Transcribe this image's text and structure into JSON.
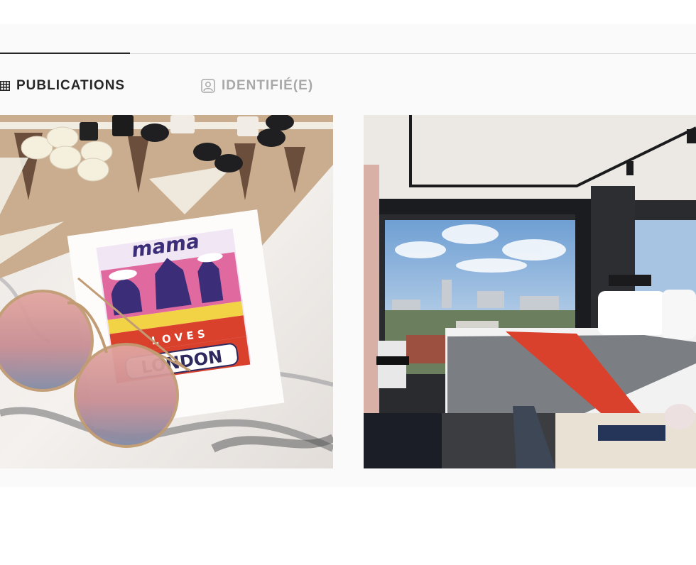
{
  "tabs": [
    {
      "label": "PUBLICATIONS",
      "icon": "grid-icon",
      "active": true
    },
    {
      "label": "IDENTIFIÉ(E)",
      "icon": "tagged-user-icon",
      "active": false
    }
  ],
  "posts": [
    {
      "image": "backgammon-board-sunglasses-card",
      "card_text": {
        "top": "mama",
        "middle": "L O V E S",
        "bottom": "LONDON"
      }
    },
    {
      "image": "hotel-bedroom-city-view"
    }
  ],
  "colors": {
    "active_text": "#262626",
    "inactive_text": "#a8a8a8",
    "divider": "#dbdbdb",
    "panel_bg": "#fafafa"
  }
}
